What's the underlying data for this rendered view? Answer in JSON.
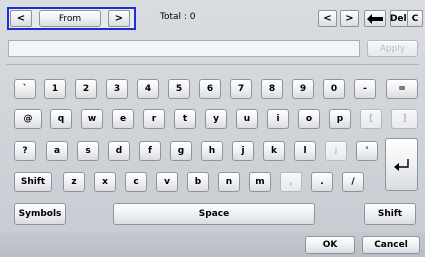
{
  "header": {
    "prev_label": "<",
    "next_label": ">",
    "direction_label": "From",
    "total_text": "Total : 0",
    "nav_left": "<",
    "nav_right": ">",
    "backspace_icon": "backspace-arrow-icon",
    "del_label": "Del.",
    "clear_label": "C"
  },
  "input": {
    "value": "",
    "apply_label": "Apply"
  },
  "keyboard": {
    "row1": [
      "`",
      "1",
      "2",
      "3",
      "4",
      "5",
      "6",
      "7",
      "8",
      "9",
      "0",
      "-",
      "="
    ],
    "row2": [
      "@",
      "q",
      "w",
      "e",
      "r",
      "t",
      "y",
      "u",
      "i",
      "o",
      "p",
      "[",
      "]"
    ],
    "row3": [
      "?",
      "a",
      "s",
      "d",
      "f",
      "g",
      "h",
      "j",
      "k",
      "l",
      ";",
      "'"
    ],
    "row4": [
      "Shift",
      "z",
      "x",
      "c",
      "v",
      "b",
      "n",
      "m",
      ",",
      ".",
      "/"
    ],
    "row5": [
      "Symbols",
      "Space",
      "Shift"
    ],
    "enter_icon": "enter-arrow-icon"
  },
  "footer": {
    "ok_label": "OK",
    "cancel_label": "Cancel"
  },
  "colors": {
    "focus_border": "#1d2fcf",
    "panel": "#c6cbd1"
  }
}
